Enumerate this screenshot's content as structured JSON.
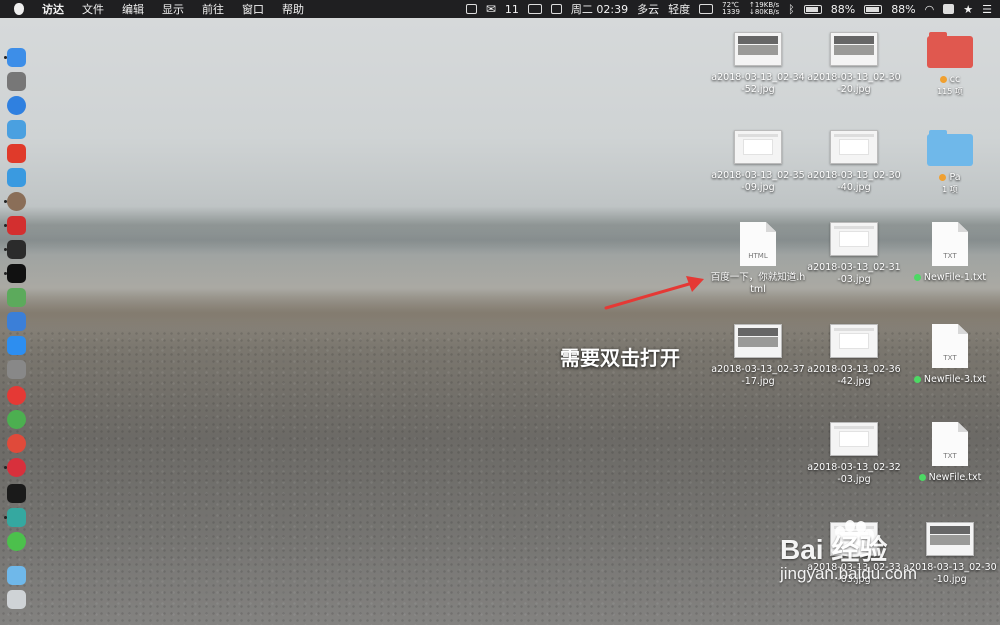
{
  "menubar": {
    "app_name": "访达",
    "menus": [
      "文件",
      "编辑",
      "显示",
      "前往",
      "窗口",
      "帮助"
    ],
    "wechat_count": "11",
    "temp": "72℃",
    "fan": "1339",
    "net_up": "↑19KB/s",
    "net_down": "↓80KB/s",
    "datetime": "周二 02:39",
    "weather": "多云",
    "air": "轻度",
    "battery_a": "88%",
    "battery_b": "88%"
  },
  "desktop": [
    {
      "kind": "thumb",
      "label": "a2018-03-13_02-34-52.jpg"
    },
    {
      "kind": "thumb",
      "label": "a2018-03-13_02-30-20.jpg"
    },
    {
      "kind": "folder",
      "label": "cc",
      "sub": "115 项",
      "color": "#e0584f",
      "tag": "#f0a030"
    },
    {
      "kind": "thumb-light",
      "label": "a2018-03-13_02-35-09.jpg"
    },
    {
      "kind": "thumb-light",
      "label": "a2018-03-13_02-30-40.jpg"
    },
    {
      "kind": "folder",
      "label": "Pa",
      "sub": "1 项",
      "color": "#6fb8ea",
      "tag": "#f0a030"
    },
    {
      "kind": "doc",
      "ext": "HTML",
      "label": "百度一下，你就知道.html"
    },
    {
      "kind": "thumb-light",
      "label": "a2018-03-13_02-31-03.jpg"
    },
    {
      "kind": "doc",
      "ext": "TXT",
      "label": "NewFile-1.txt",
      "tag": "#4cd964"
    },
    {
      "kind": "thumb",
      "label": "a2018-03-13_02-37-17.jpg"
    },
    {
      "kind": "thumb-light",
      "label": "a2018-03-13_02-36-42.jpg"
    },
    {
      "kind": "doc",
      "ext": "TXT",
      "label": "NewFile-3.txt",
      "tag": "#4cd964"
    },
    {
      "kind": "thumb-light",
      "label": "a2018-03-13_02-32-03.jpg"
    },
    {
      "kind": "doc",
      "ext": "TXT",
      "label": "NewFile.txt",
      "tag": "#4cd964"
    },
    {
      "kind": "thumb-light",
      "label": "a2018-03-13_02-33-03.jpg"
    },
    {
      "kind": "thumb",
      "label": "a2018-03-13_02-30-10.jpg"
    }
  ],
  "dock": [
    {
      "name": "finder-icon",
      "color": "#3d8ee8"
    },
    {
      "name": "launchpad-icon",
      "color": "#777"
    },
    {
      "name": "safari-icon",
      "color": "#2f80e0"
    },
    {
      "name": "preview-icon",
      "color": "#4aa0e0"
    },
    {
      "name": "app-red-icon",
      "color": "#e03a2a"
    },
    {
      "name": "migration-icon",
      "color": "#3a9ae0"
    },
    {
      "name": "basketball-icon",
      "color": "#8a6e58"
    },
    {
      "name": "netease-music-icon",
      "color": "#d32f2f"
    },
    {
      "name": "activity-monitor-icon",
      "color": "#2b2b2b"
    },
    {
      "name": "terminal-icon",
      "color": "#111"
    },
    {
      "name": "maps-icon",
      "color": "#5caa5c"
    },
    {
      "name": "siri-icon",
      "color": "#3b7fd8"
    },
    {
      "name": "app-store-icon",
      "color": "#2d8ef0"
    },
    {
      "name": "system-prefs-icon",
      "color": "#888"
    },
    {
      "name": "yandex-icon",
      "color": "#e53935"
    },
    {
      "name": "chrome-icon",
      "color": "#4caf50"
    },
    {
      "name": "weibo-icon",
      "color": "#e04a3a"
    },
    {
      "name": "vivaldi-icon",
      "color": "#d8303c"
    },
    {
      "name": "iterm-icon",
      "color": "#1a1a1a"
    },
    {
      "name": "app-teal-icon",
      "color": "#35a8a0"
    },
    {
      "name": "wechat-icon",
      "color": "#4cc04c"
    },
    {
      "name": "downloads-folder-icon",
      "color": "#6fb8ea"
    },
    {
      "name": "trash-icon",
      "color": "#cfd3d6"
    }
  ],
  "annotation": "需要双击打开",
  "watermark": {
    "logo": "Bai 经验",
    "url": "jingyan.baidu.com"
  }
}
